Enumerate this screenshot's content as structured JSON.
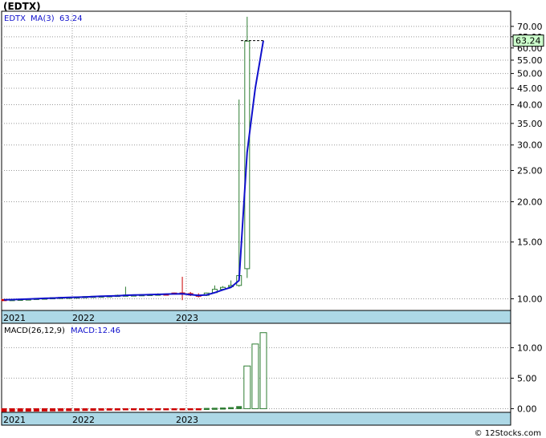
{
  "title": "(EDTX)",
  "credit": "© 12Stocks.com",
  "colors": {
    "up": "#2e7d32",
    "down": "#cc0000",
    "ma": "#1010cc",
    "axis_band": "#add8e6",
    "last_price_bg": "#ccffcc",
    "grid": "#999999"
  },
  "chart_data": [
    {
      "type": "candlestick",
      "legend": {
        "symbol": "EDTX",
        "ma_label": "MA(3)",
        "ma_value": "63.24"
      },
      "last_price": "63.24",
      "y_scale": "log",
      "ylim": [
        9.2,
        78
      ],
      "y_ticks": [
        10,
        15,
        20,
        25,
        30,
        35,
        40,
        45,
        50,
        55,
        60,
        65,
        70
      ],
      "y_tick_labels": [
        "10.00",
        "15.00",
        "20.00",
        "25.00",
        "30.00",
        "35.00",
        "40.00",
        "45.00",
        "50.00",
        "55.00",
        "60.00",
        "65.00",
        "70.00"
      ],
      "x_labels": [
        "2021",
        "2022",
        "2023"
      ],
      "ohlc": [
        {
          "o": 9.95,
          "h": 9.98,
          "l": 9.9,
          "c": 9.92
        },
        {
          "o": 9.94,
          "h": 9.98,
          "l": 9.9,
          "c": 9.95
        },
        {
          "o": 9.96,
          "h": 10.0,
          "l": 9.93,
          "c": 9.97
        },
        {
          "o": 9.98,
          "h": 10.02,
          "l": 9.95,
          "c": 9.99
        },
        {
          "o": 10.0,
          "h": 10.05,
          "l": 9.97,
          "c": 10.03
        },
        {
          "o": 10.04,
          "h": 10.07,
          "l": 10.01,
          "c": 10.05
        },
        {
          "o": 10.06,
          "h": 10.1,
          "l": 10.03,
          "c": 10.08
        },
        {
          "o": 10.08,
          "h": 10.12,
          "l": 10.05,
          "c": 10.1
        },
        {
          "o": 10.1,
          "h": 10.14,
          "l": 10.07,
          "c": 10.11
        },
        {
          "o": 10.12,
          "h": 10.15,
          "l": 10.09,
          "c": 10.13
        },
        {
          "o": 10.14,
          "h": 10.18,
          "l": 10.1,
          "c": 10.16
        },
        {
          "o": 10.16,
          "h": 10.2,
          "l": 10.12,
          "c": 10.18
        },
        {
          "o": 10.18,
          "h": 10.22,
          "l": 10.15,
          "c": 10.2
        },
        {
          "o": 10.2,
          "h": 10.25,
          "l": 10.17,
          "c": 10.22
        },
        {
          "o": 10.22,
          "h": 10.3,
          "l": 10.18,
          "c": 10.25
        },
        {
          "o": 10.24,
          "h": 10.9,
          "l": 10.2,
          "c": 10.27
        },
        {
          "o": 10.27,
          "h": 10.32,
          "l": 10.22,
          "c": 10.28
        },
        {
          "o": 10.28,
          "h": 10.33,
          "l": 10.24,
          "c": 10.3
        },
        {
          "o": 10.3,
          "h": 10.35,
          "l": 10.26,
          "c": 10.32
        },
        {
          "o": 10.32,
          "h": 10.4,
          "l": 10.28,
          "c": 10.34
        },
        {
          "o": 10.35,
          "h": 10.38,
          "l": 10.3,
          "c": 10.33
        },
        {
          "o": 10.42,
          "h": 10.45,
          "l": 10.33,
          "c": 10.35
        },
        {
          "o": 10.43,
          "h": 11.7,
          "l": 9.9,
          "c": 10.36
        },
        {
          "o": 10.38,
          "h": 10.5,
          "l": 10.2,
          "c": 10.27
        },
        {
          "o": 10.27,
          "h": 10.4,
          "l": 10.1,
          "c": 10.22
        },
        {
          "o": 10.25,
          "h": 10.45,
          "l": 10.2,
          "c": 10.42
        },
        {
          "o": 10.45,
          "h": 11.0,
          "l": 10.4,
          "c": 10.7
        },
        {
          "o": 10.7,
          "h": 10.95,
          "l": 10.6,
          "c": 10.85
        },
        {
          "o": 10.9,
          "h": 11.4,
          "l": 10.8,
          "c": 11.0
        },
        {
          "o": 11.0,
          "h": 41.5,
          "l": 10.9,
          "c": 11.8
        },
        {
          "o": 12.4,
          "h": 75.0,
          "l": 11.6,
          "c": 63.0
        }
      ],
      "ma_values": [
        9.93,
        9.94,
        9.96,
        9.98,
        10.0,
        10.03,
        10.05,
        10.08,
        10.1,
        10.11,
        10.13,
        10.16,
        10.18,
        10.2,
        10.22,
        10.25,
        10.27,
        10.28,
        10.3,
        10.32,
        10.34,
        10.35,
        10.36,
        10.3,
        10.24,
        10.28,
        10.45,
        10.66,
        10.85,
        11.4,
        28.5,
        45.0,
        63.24
      ]
    },
    {
      "type": "bar",
      "legend": {
        "label": "MACD(26,12,9)",
        "value_label": "MACD:12.46"
      },
      "ylim": [
        -0.6,
        14
      ],
      "y_ticks": [
        0,
        5,
        10
      ],
      "y_tick_labels": [
        "0.00",
        "5.00",
        "10.00"
      ],
      "x_labels": [
        "2021",
        "2022",
        "2023"
      ],
      "values": [
        -0.45,
        -0.42,
        -0.41,
        -0.4,
        -0.39,
        -0.38,
        -0.36,
        -0.34,
        -0.33,
        -0.31,
        -0.3,
        -0.28,
        -0.26,
        -0.24,
        -0.22,
        -0.2,
        -0.18,
        -0.16,
        -0.14,
        -0.12,
        -0.1,
        -0.08,
        -0.06,
        -0.04,
        -0.03,
        0.05,
        0.08,
        0.12,
        0.18,
        0.35,
        7.0,
        10.6,
        12.46
      ]
    }
  ]
}
